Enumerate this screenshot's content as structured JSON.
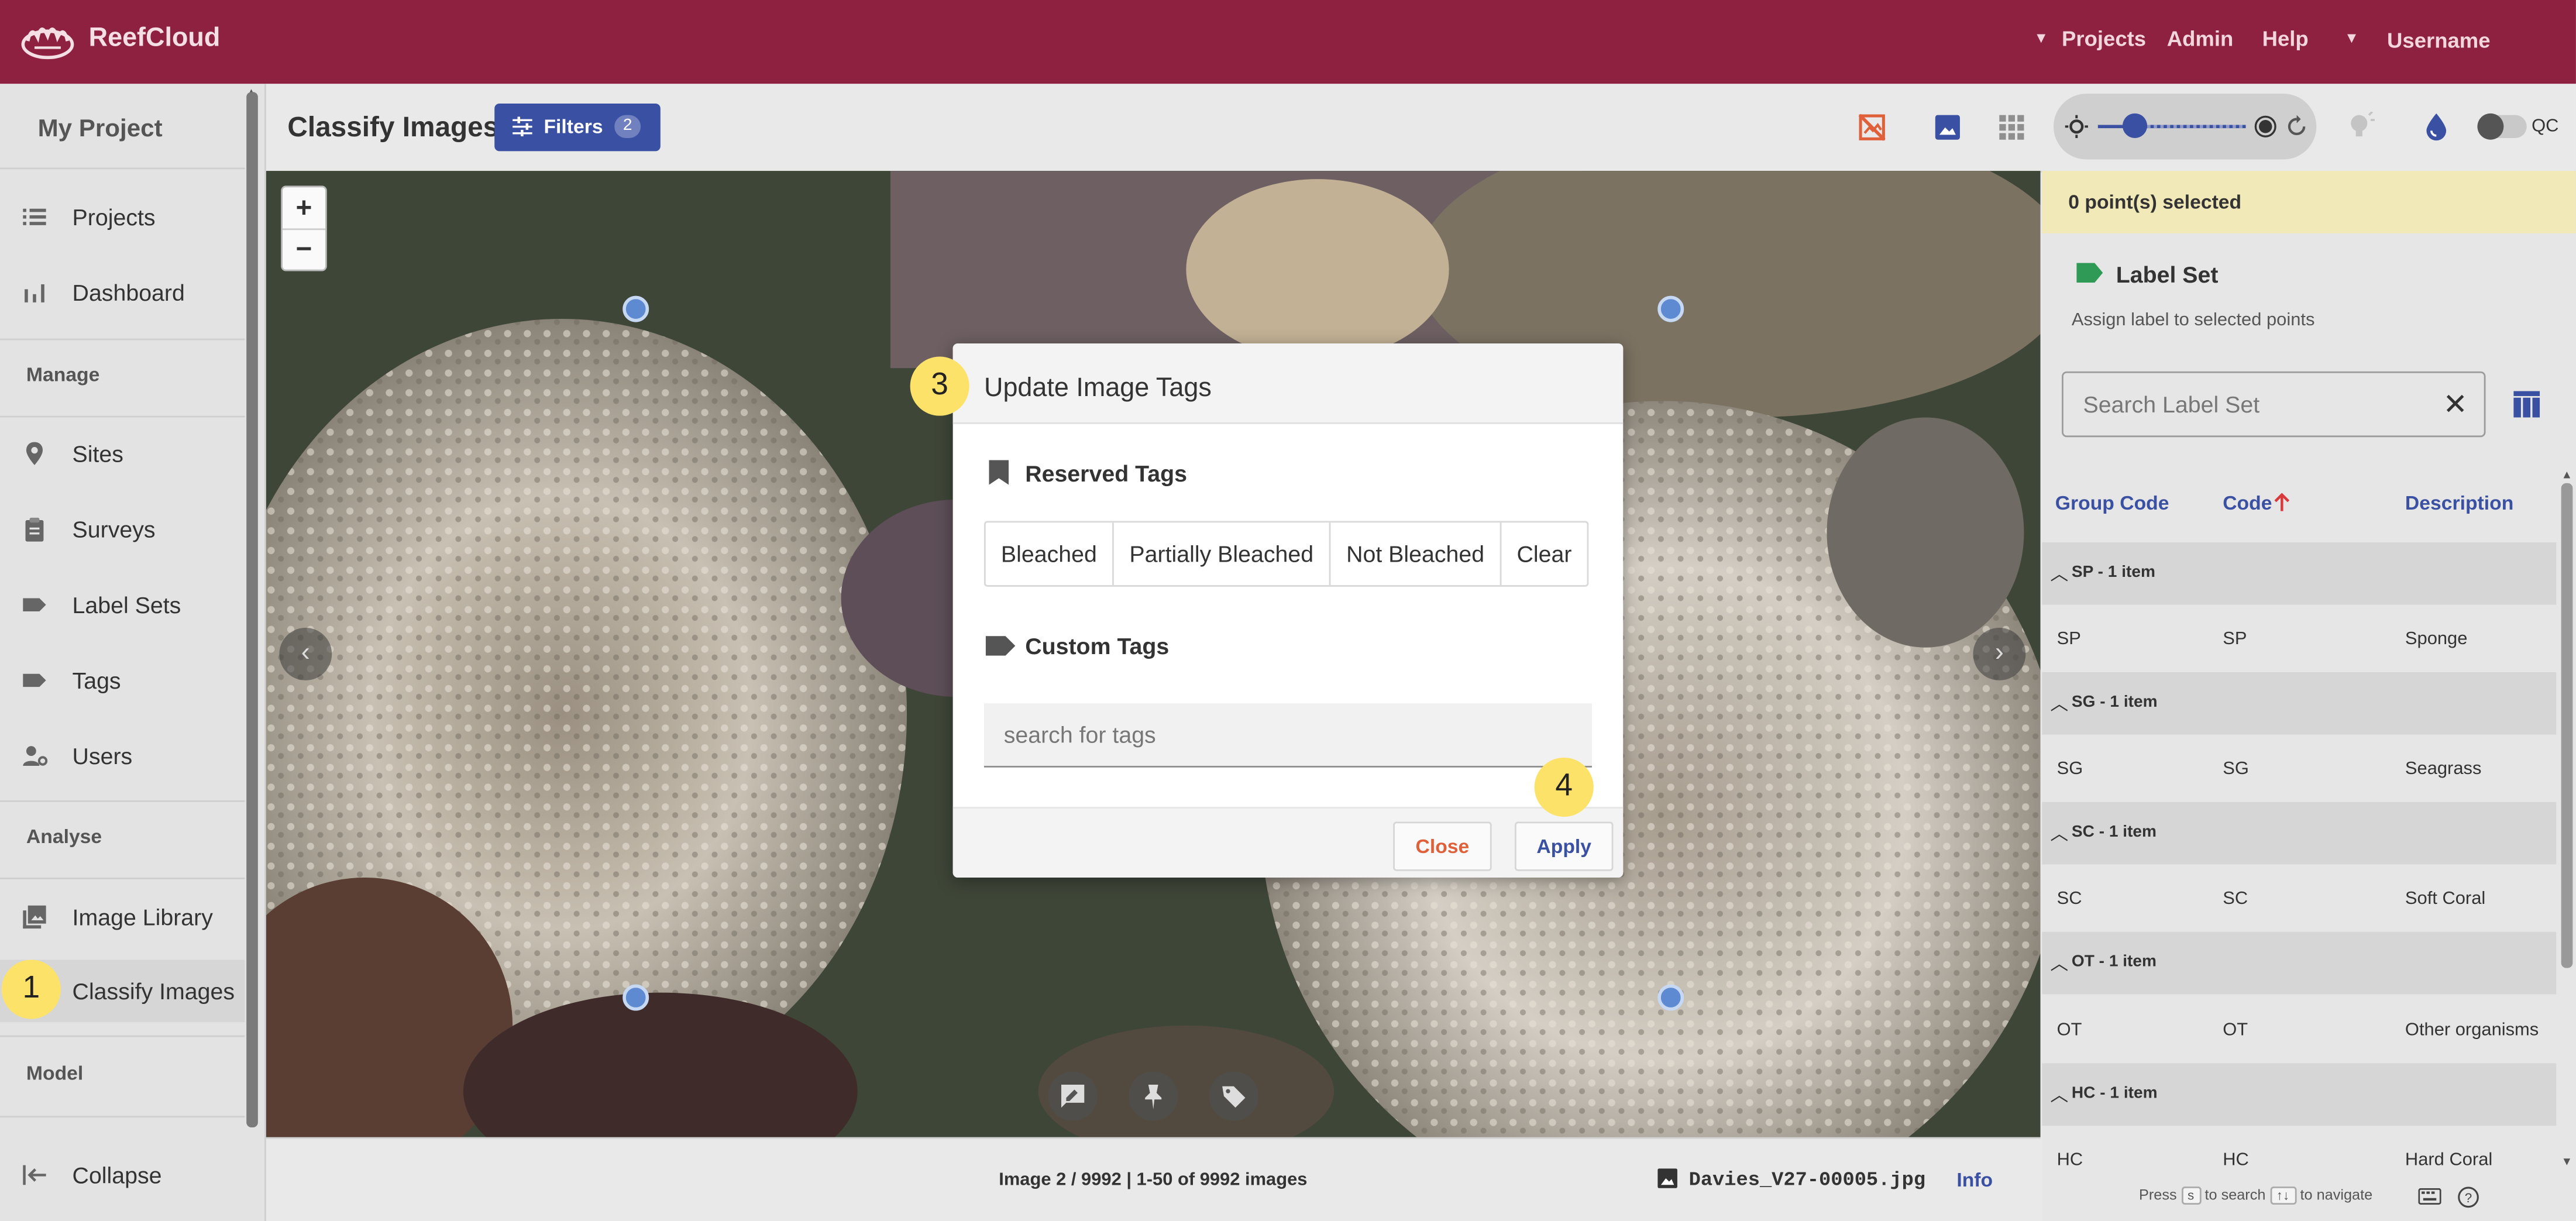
{
  "topbar": {
    "app_name": "ReefCloud",
    "nav": [
      "Projects",
      "Admin",
      "Help"
    ],
    "user": "Username"
  },
  "sidebar": {
    "project_name": "My Project",
    "items": [
      {
        "label": "Projects",
        "icon": "list-icon"
      },
      {
        "label": "Dashboard",
        "icon": "bar-chart-icon"
      }
    ],
    "manage_title": "Manage",
    "manage_items": [
      {
        "label": "Sites",
        "icon": "location-pin-icon"
      },
      {
        "label": "Surveys",
        "icon": "clipboard-icon"
      },
      {
        "label": "Label Sets",
        "icon": "label-icon"
      },
      {
        "label": "Tags",
        "icon": "label-icon"
      },
      {
        "label": "Users",
        "icon": "user-gear-icon"
      }
    ],
    "analyse_title": "Analyse",
    "analyse_items": [
      {
        "label": "Image Library",
        "icon": "photo-library-icon"
      },
      {
        "label": "Classify Images",
        "icon": "touch-icon"
      }
    ],
    "model_title": "Model",
    "collapse_label": "Collapse"
  },
  "header": {
    "title": "Classify Images",
    "filters_label": "Filters",
    "filters_count": "2",
    "qc_label": "QC"
  },
  "viewer": {
    "zoom_in": "+",
    "zoom_out": "−"
  },
  "footer": {
    "status": "Image 2 / 9992 | 1-50 of 9992 images",
    "filename": "Davies_V27-00005.jpg",
    "info": "Info"
  },
  "right_panel": {
    "selected": "0 point(s) selected",
    "label_set_title": "Label Set",
    "label_set_subtitle": "Assign label to selected points",
    "search_placeholder": "Search Label Set",
    "columns": [
      "Group Code",
      "Code",
      "Description"
    ],
    "groups": [
      {
        "header": "SP - 1 item",
        "group": "SP",
        "code": "SP",
        "desc": "Sponge"
      },
      {
        "header": "SG - 1 item",
        "group": "SG",
        "code": "SG",
        "desc": "Seagrass"
      },
      {
        "header": "SC - 1 item",
        "group": "SC",
        "code": "SC",
        "desc": "Soft Coral"
      },
      {
        "header": "OT - 1 item",
        "group": "OT",
        "code": "OT",
        "desc": "Other organisms"
      },
      {
        "header": "HC - 1 item",
        "group": "HC",
        "code": "HC",
        "desc": "Hard Coral"
      }
    ],
    "footer_press": "Press",
    "footer_key_search": "s",
    "footer_to_search": "to search",
    "footer_key_nav": "↑↓",
    "footer_to_navigate": "to navigate"
  },
  "dialog": {
    "title": "Update Image Tags",
    "reserved_title": "Reserved Tags",
    "reserved_tags": [
      "Bleached",
      "Partially Bleached",
      "Not Bleached",
      "Clear"
    ],
    "custom_title": "Custom Tags",
    "search_placeholder": "search for tags",
    "close": "Close",
    "apply": "Apply"
  },
  "steps": [
    "1",
    "3",
    "4"
  ],
  "colors": {
    "brand": "#8e2140",
    "accent": "#3a50a2",
    "selection_bar": "#f1e9b8",
    "step_marker": "#fde26a",
    "close_button": "#e0603a"
  }
}
